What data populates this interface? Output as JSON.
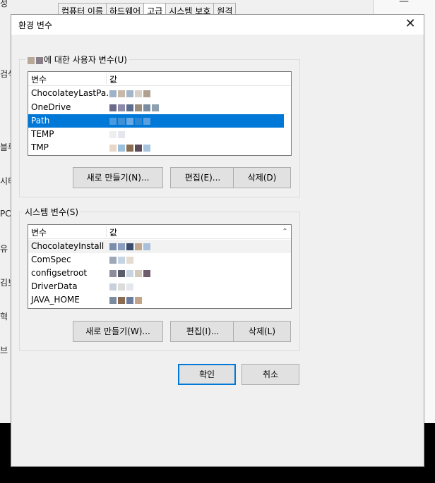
{
  "background": {
    "tabs": [
      "컴퓨터 이름",
      "하드웨어",
      "고급",
      "시스템 보호",
      "원격"
    ],
    "left_fragments": [
      "성",
      "검색",
      "블루",
      "시티",
      "PC",
      "유",
      "김보",
      "혁",
      "브"
    ],
    "right_window_glyph": "—"
  },
  "dialog": {
    "title": "환경 변수",
    "close_glyph": "✕",
    "user_vars": {
      "group_label": "에 대한 사용자 변수(U)",
      "col_name": "변수",
      "col_value": "값",
      "rows": [
        "ChocolateyLastPa...",
        "OneDrive",
        "Path",
        "TEMP",
        "TMP"
      ],
      "selected": "Path",
      "buttons": {
        "new": "새로 만들기(N)...",
        "edit": "편집(E)...",
        "delete": "삭제(D)"
      }
    },
    "system_vars": {
      "group_label": "시스템 변수(S)",
      "col_name": "변수",
      "col_value": "값",
      "rows": [
        "ChocolateyInstall",
        "ComSpec",
        "configsetroot",
        "DriverData",
        "JAVA_HOME"
      ],
      "scroll_glyph": "⌃",
      "buttons": {
        "new": "새로 만들기(W)...",
        "edit": "편집(I)...",
        "delete": "삭제(L)"
      }
    },
    "ok": "확인",
    "cancel": "취소"
  },
  "colors": {
    "selection": "#0078d7",
    "dialog_bg": "#f0f0f0",
    "taskbar": "#000000"
  }
}
